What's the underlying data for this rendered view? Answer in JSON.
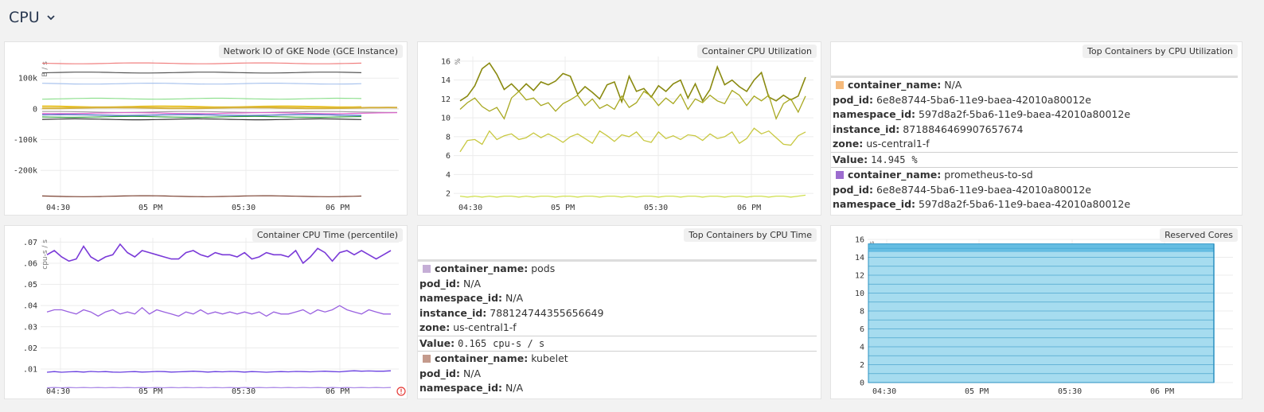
{
  "header": {
    "title": "CPU"
  },
  "panels": {
    "network": {
      "title": "Network IO of GKE Node (GCE Instance)"
    },
    "cpu_util": {
      "title": "Container CPU Utilization"
    },
    "top_cpu_util": {
      "title": "Top Containers by CPU Utilization"
    },
    "cpu_time_pct": {
      "title": "Container CPU Time (percentile)"
    },
    "top_cpu_time": {
      "title": "Top Containers by CPU Time"
    },
    "reserved": {
      "title": "Reserved Cores"
    }
  },
  "top_cpu_util": {
    "entries": [
      {
        "color": "#f5b97a",
        "container_name": "N/A",
        "pod_id": "6e8e8744-5ba6-11e9-baea-42010a80012e",
        "namespace_id": "597d8a2f-5ba6-11e9-baea-42010a80012e",
        "instance_id": "8718846469907657674",
        "zone": "us-central1-f",
        "value": "14.945",
        "unit": "%"
      },
      {
        "color": "#9c6ccf",
        "container_name": "prometheus-to-sd",
        "pod_id": "6e8e8744-5ba6-11e9-baea-42010a80012e",
        "namespace_id": "597d8a2f-5ba6-11e9-baea-42010a80012e",
        "instance_id": "8718846469907657674"
      }
    ],
    "labels": {
      "container_name": "container_name:",
      "pod_id": "pod_id:",
      "namespace_id": "namespace_id:",
      "instance_id": "instance_id:",
      "zone": "zone:",
      "value": "Value:"
    }
  },
  "top_cpu_time": {
    "entries": [
      {
        "color": "#c5aed6",
        "container_name": "pods",
        "pod_id": "N/A",
        "namespace_id": "N/A",
        "instance_id": "788124744355656649",
        "zone": "us-central1-f",
        "value": "0.165",
        "unit": "cpu-s / s"
      },
      {
        "color": "#c49a8c",
        "container_name": "kubelet",
        "pod_id": "N/A",
        "namespace_id": "N/A",
        "instance_id": "788124744355656649"
      }
    ]
  },
  "chart_data": [
    {
      "type": "line",
      "title": "Network IO of GKE Node (GCE Instance)",
      "ylabel": "B / s",
      "ylim": [
        -290000,
        160000
      ],
      "yticks": [
        "100k",
        "0",
        "-100k",
        "-200k"
      ],
      "xticks": [
        "04:30",
        "05 PM",
        "05:30",
        "06 PM"
      ],
      "series": [
        {
          "color": "#f08080",
          "level": 148000
        },
        {
          "color": "#555555",
          "level": 118000
        },
        {
          "color": "#aac4ee",
          "level": 82000
        },
        {
          "color": "#90e090",
          "level": 33000
        },
        {
          "color": "#e8c020",
          "level": 7000
        },
        {
          "color": "#d4b040",
          "level": 3000
        },
        {
          "color": "#a0a0a0",
          "level": -10000
        },
        {
          "color": "#e060d0",
          "level": -14000
        },
        {
          "color": "#4060c0",
          "level": -20000
        },
        {
          "color": "#30a040",
          "level": -26000
        },
        {
          "color": "#333333",
          "level": -34000
        },
        {
          "color": "#7a4030",
          "level": -284000
        }
      ],
      "grid": true
    },
    {
      "type": "line",
      "title": "Container CPU Utilization",
      "ylabel": "%",
      "ylim": [
        1.5,
        16.5
      ],
      "yticks": [
        2,
        4,
        6,
        8,
        10,
        12,
        14,
        16
      ],
      "xticks": [
        "04:30",
        "05 PM",
        "05:30",
        "06 PM"
      ],
      "series": [
        {
          "color": "#8a8a10",
          "values": [
            11.8,
            12.3,
            13.4,
            15.2,
            15.8,
            14.6,
            13.0,
            13.6,
            12.8,
            13.6,
            12.9,
            13.8,
            13.5,
            13.9,
            14.7,
            14.4,
            12.5,
            13.3,
            12.7,
            12.0,
            13.5,
            13.8,
            11.7,
            14.4,
            12.8,
            13.1,
            12.2,
            13.4,
            12.8,
            13.6,
            14.0,
            12.1,
            13.6,
            11.8,
            13.0,
            15.4,
            13.5,
            14.0,
            13.3,
            12.8,
            14.0,
            14.8,
            12.2,
            11.8,
            12.4,
            11.9,
            12.3,
            14.3
          ]
        },
        {
          "color": "#a8a820",
          "values": [
            10.9,
            11.6,
            12.1,
            11.2,
            10.7,
            11.1,
            9.9,
            12.1,
            12.8,
            11.9,
            12.1,
            11.3,
            11.6,
            10.7,
            11.5,
            11.9,
            12.4,
            11.3,
            12.0,
            11.0,
            11.4,
            10.9,
            12.3,
            11.1,
            11.6,
            12.8,
            12.3,
            11.3,
            12.1,
            11.5,
            12.5,
            10.9,
            12.0,
            11.6,
            12.4,
            11.8,
            11.5,
            12.9,
            12.4,
            11.3,
            12.3,
            11.8,
            12.4,
            9.9,
            11.5,
            12.0,
            10.6,
            12.3
          ]
        },
        {
          "color": "#c8c840",
          "values": [
            6.4,
            7.6,
            7.7,
            7.2,
            8.6,
            7.7,
            8.1,
            8.3,
            7.7,
            7.9,
            8.4,
            7.9,
            8.3,
            7.9,
            7.4,
            8.0,
            8.3,
            7.8,
            7.3,
            8.6,
            8.1,
            7.5,
            8.2,
            8.0,
            8.5,
            7.6,
            7.4,
            8.5,
            7.8,
            8.1,
            7.7,
            8.2,
            8.1,
            7.6,
            8.3,
            7.8,
            8.0,
            8.5,
            7.3,
            7.8,
            8.9,
            8.3,
            8.6,
            7.9,
            7.2,
            7.1,
            8.1,
            8.5
          ]
        },
        {
          "color": "#d0e050",
          "values": [
            1.7,
            1.6,
            1.7,
            1.6,
            1.7,
            1.6,
            1.7,
            1.7,
            1.6,
            1.7,
            1.6,
            1.7,
            1.7,
            1.6,
            1.7,
            1.7,
            1.6,
            1.7,
            1.7,
            1.6,
            1.7,
            1.7,
            1.6,
            1.7,
            1.6,
            1.7,
            1.7,
            1.6,
            1.7,
            1.7,
            1.6,
            1.7,
            1.7,
            1.6,
            1.7,
            1.7,
            1.6,
            1.7,
            1.7,
            1.6,
            1.7,
            1.7,
            1.6,
            1.7,
            1.7,
            1.6,
            1.7,
            1.8
          ]
        }
      ],
      "grid": true
    },
    {
      "type": "line",
      "title": "Container CPU Time (percentile)",
      "ylabel": "cpu-s / s",
      "ylim": [
        0.004,
        0.072
      ],
      "yticks": [
        ".07",
        ".06",
        ".05",
        ".04",
        ".03",
        ".02",
        ".01"
      ],
      "xticks": [
        "04:30",
        "05 PM",
        "05:30",
        "06 PM"
      ],
      "series": [
        {
          "color": "#7a3ad8",
          "values": [
            0.064,
            0.066,
            0.063,
            0.061,
            0.062,
            0.068,
            0.063,
            0.061,
            0.063,
            0.064,
            0.069,
            0.065,
            0.063,
            0.066,
            0.065,
            0.064,
            0.063,
            0.062,
            0.062,
            0.065,
            0.066,
            0.064,
            0.063,
            0.065,
            0.064,
            0.064,
            0.063,
            0.065,
            0.062,
            0.063,
            0.065,
            0.064,
            0.064,
            0.063,
            0.066,
            0.06,
            0.063,
            0.067,
            0.065,
            0.061,
            0.065,
            0.066,
            0.064,
            0.066,
            0.064,
            0.062,
            0.064,
            0.066
          ]
        },
        {
          "color": "#9a62e0",
          "values": [
            0.037,
            0.038,
            0.038,
            0.037,
            0.036,
            0.038,
            0.037,
            0.035,
            0.037,
            0.038,
            0.036,
            0.037,
            0.036,
            0.039,
            0.036,
            0.038,
            0.037,
            0.036,
            0.035,
            0.037,
            0.036,
            0.038,
            0.036,
            0.037,
            0.036,
            0.037,
            0.036,
            0.037,
            0.036,
            0.037,
            0.035,
            0.037,
            0.036,
            0.036,
            0.037,
            0.038,
            0.036,
            0.038,
            0.037,
            0.038,
            0.04,
            0.038,
            0.037,
            0.036,
            0.038,
            0.037,
            0.036,
            0.036
          ]
        },
        {
          "color": "#6a40e0",
          "values": [
            0.0085,
            0.0088,
            0.0085,
            0.0087,
            0.0088,
            0.0086,
            0.0089,
            0.0087,
            0.0088,
            0.0086,
            0.0085,
            0.0087,
            0.0088,
            0.0086,
            0.0087,
            0.0089,
            0.0088,
            0.0086,
            0.0087,
            0.0088,
            0.009,
            0.0088,
            0.0086,
            0.0088,
            0.0087,
            0.0089,
            0.0088,
            0.0086,
            0.0088,
            0.0087,
            0.0085,
            0.0087,
            0.0088,
            0.0087,
            0.0089,
            0.0088,
            0.0087,
            0.0089,
            0.009,
            0.0088,
            0.0087,
            0.009,
            0.0092,
            0.009,
            0.0091,
            0.009,
            0.009,
            0.0092
          ]
        },
        {
          "color": "#b090e8",
          "values": [
            0.0012,
            0.0013,
            0.0012,
            0.0013,
            0.0012,
            0.0013,
            0.0012,
            0.0013,
            0.0012,
            0.0013,
            0.0012,
            0.0013,
            0.0012,
            0.0013,
            0.0012,
            0.0013,
            0.0012,
            0.0013,
            0.0012,
            0.0013,
            0.0012,
            0.0013,
            0.0012,
            0.0013,
            0.0012,
            0.0013,
            0.0012,
            0.0013,
            0.0012,
            0.0013,
            0.0012,
            0.0013,
            0.0012,
            0.0013,
            0.0012,
            0.0013,
            0.0012,
            0.0013,
            0.0012,
            0.0013,
            0.0012,
            0.0013,
            0.0012,
            0.0013,
            0.0012,
            0.0013,
            0.0012,
            0.0013
          ]
        }
      ],
      "grid": true
    },
    {
      "type": "area",
      "title": "Reserved Cores",
      "ylabel": "cores",
      "ylim": [
        0,
        16
      ],
      "yticks": [
        16,
        14,
        12,
        10,
        8,
        6,
        4,
        2,
        0
      ],
      "xticks": [
        "04:30",
        "05 PM",
        "05:30",
        "06 PM"
      ],
      "stack_count": 15,
      "total": 15.5,
      "colors": {
        "fill": "#a6dcef",
        "stroke": "#2a90c0",
        "top": "#3aa8d8"
      },
      "grid": true
    }
  ]
}
